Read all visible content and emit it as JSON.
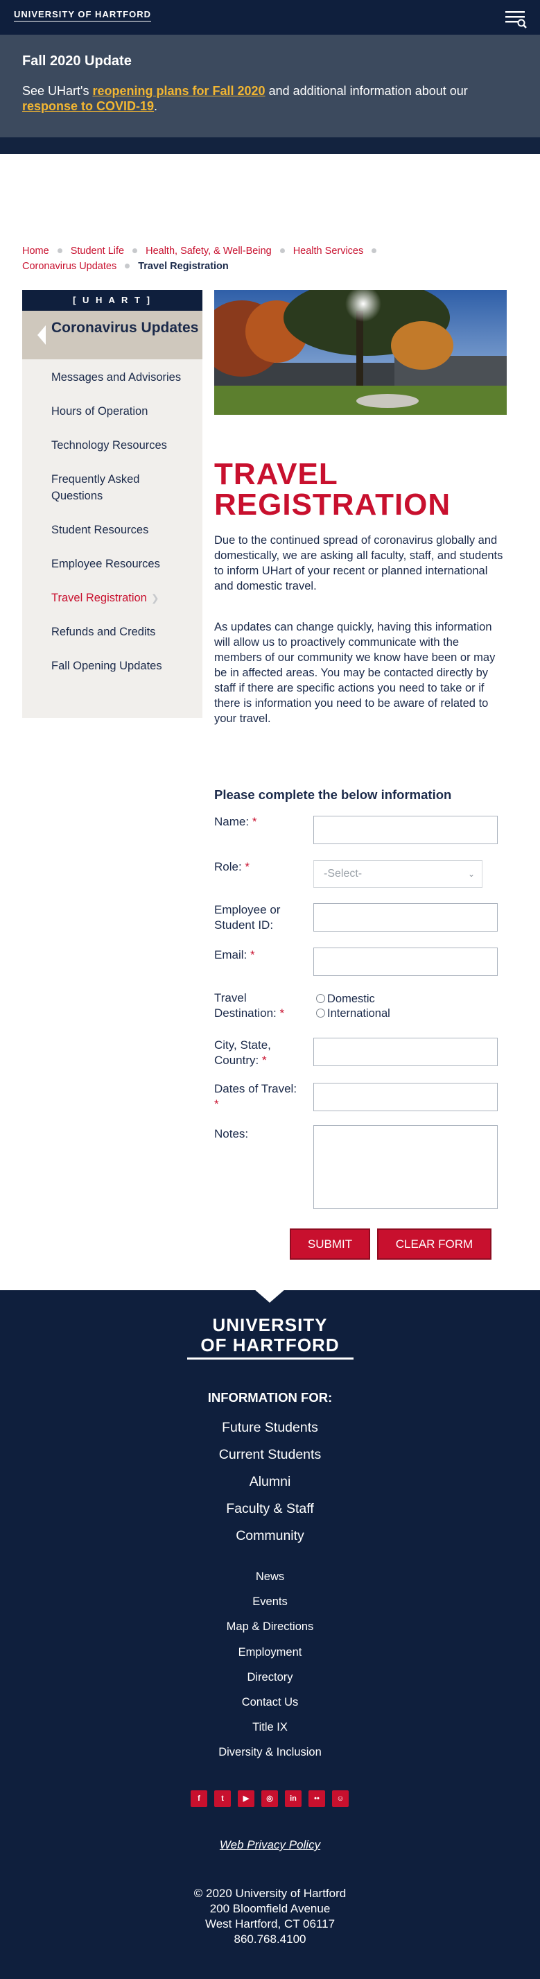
{
  "header": {
    "logo_text": "UNIVERSITY OF HARTFORD",
    "menu_icon": "menu-search-icon"
  },
  "alert": {
    "title": "Fall 2020 Update",
    "text_prefix": "See UHart's ",
    "link1": "reopening plans for Fall 2020",
    "text_middle": " and additional information about our ",
    "link2": "response to COVID-19",
    "text_suffix": "."
  },
  "breadcrumb": {
    "items": [
      "Home",
      "Student Life",
      "Health, Safety, & Well-Being",
      "Health Services",
      "Coronavirus Updates"
    ],
    "current": "Travel Registration"
  },
  "sidebar": {
    "brand": "[ U H A R T ]",
    "title": "Coronavirus Updates",
    "items": [
      {
        "label": "Messages and Advisories"
      },
      {
        "label": "Hours of Operation"
      },
      {
        "label": "Technology Resources"
      },
      {
        "label": "Frequently Asked Questions"
      },
      {
        "label": "Student Resources"
      },
      {
        "label": "Employee Resources"
      },
      {
        "label": "Travel Registration"
      },
      {
        "label": "Refunds and Credits"
      },
      {
        "label": "Fall Opening Updates"
      }
    ],
    "active_index": 6
  },
  "main": {
    "title": "TRAVEL REGISTRATION",
    "para1": "Due to the continued spread of coronavirus globally and domestically, we are asking all faculty, staff, and students to inform UHart of your recent or planned international and domestic travel.",
    "para2": "As updates can change quickly, having this information will allow us to proactively communicate with the members of our community we know have been or may be in affected areas. You may be contacted directly by staff if there are specific actions you need to take or if there is information you need to be aware of related to your travel."
  },
  "form": {
    "title": "Please complete the below information",
    "name_label": "Name:",
    "role_label": "Role:",
    "role_selected": "-Select-",
    "id_label": "Employee or Student ID:",
    "email_label": "Email:",
    "destination_label": "Travel Destination:",
    "destination_options": [
      "Domestic",
      "International"
    ],
    "city_label": "City, State, Country:",
    "dates_label": "Dates of Travel:",
    "notes_label": "Notes:",
    "required_mark": "*",
    "submit_label": "SUBMIT",
    "clear_label": "CLEAR FORM"
  },
  "footer": {
    "logo_line1": "UNIVERSITY",
    "logo_line2": "OF HARTFORD",
    "info_heading": "INFORMATION FOR:",
    "primary_links": [
      "Future Students",
      "Current Students",
      "Alumni",
      "Faculty & Staff",
      "Community"
    ],
    "secondary_links": [
      "News",
      "Events",
      "Map & Directions",
      "Employment",
      "Directory",
      "Contact Us",
      "Title IX",
      "Diversity & Inclusion"
    ],
    "social": [
      "facebook-icon",
      "twitter-icon",
      "youtube-icon",
      "instagram-icon",
      "linkedin-icon",
      "flickr-icon",
      "snapchat-icon"
    ],
    "privacy": "Web Privacy Policy",
    "copyright": "© 2020 University of Hartford",
    "address1": "200 Bloomfield Avenue",
    "address2": "West Hartford, CT 06117",
    "phone": "860.768.4100"
  },
  "colors": {
    "navy": "#0f1f3d",
    "red": "#c8102e",
    "gold": "#f2b632",
    "banner": "#3c4a5e"
  }
}
